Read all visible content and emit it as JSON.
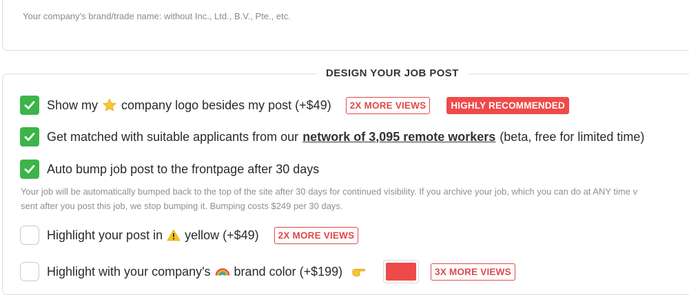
{
  "company_name": {
    "hint": "Your company's brand/trade name: without Inc., Ltd., B.V., Pte., etc."
  },
  "design": {
    "section_title": "DESIGN YOUR JOB POST",
    "options": [
      {
        "checked": true,
        "label_before": "Show my",
        "icon": "star-icon",
        "label_after": "company logo besides my post (+$49)",
        "badge_outline": "2X MORE VIEWS",
        "badge_filled": "HIGHLY RECOMMENDED"
      },
      {
        "checked": true,
        "label_before": "Get matched with suitable applicants from our",
        "link": "network of 3,095 remote workers",
        "label_after": "(beta, free for limited time)"
      },
      {
        "checked": true,
        "label": "Auto bump job post to the frontpage after 30 days",
        "help_line1": "Your job will be automatically bumped back to the top of the site after 30 days for continued visibility. If you archive your job, which you can do at ANY time v",
        "help_line2": "sent after you post this job, we stop bumping it. Bumping costs $249 per 30 days."
      },
      {
        "checked": false,
        "label_before": "Highlight your post in",
        "icon": "warning-icon",
        "label_after": "yellow (+$49)",
        "badge_outline": "2X MORE VIEWS"
      },
      {
        "checked": false,
        "label_before": "Highlight with your company's",
        "icon": "rainbow-icon",
        "label_after": "brand color (+$199)",
        "pointer_icon": "pointing-hand-icon",
        "color_value": "#ef4a4a",
        "badge_outline": "3X MORE VIEWS"
      }
    ]
  },
  "colors": {
    "check_green": "#3bb54a",
    "accent_red": "#ef4a4a"
  }
}
